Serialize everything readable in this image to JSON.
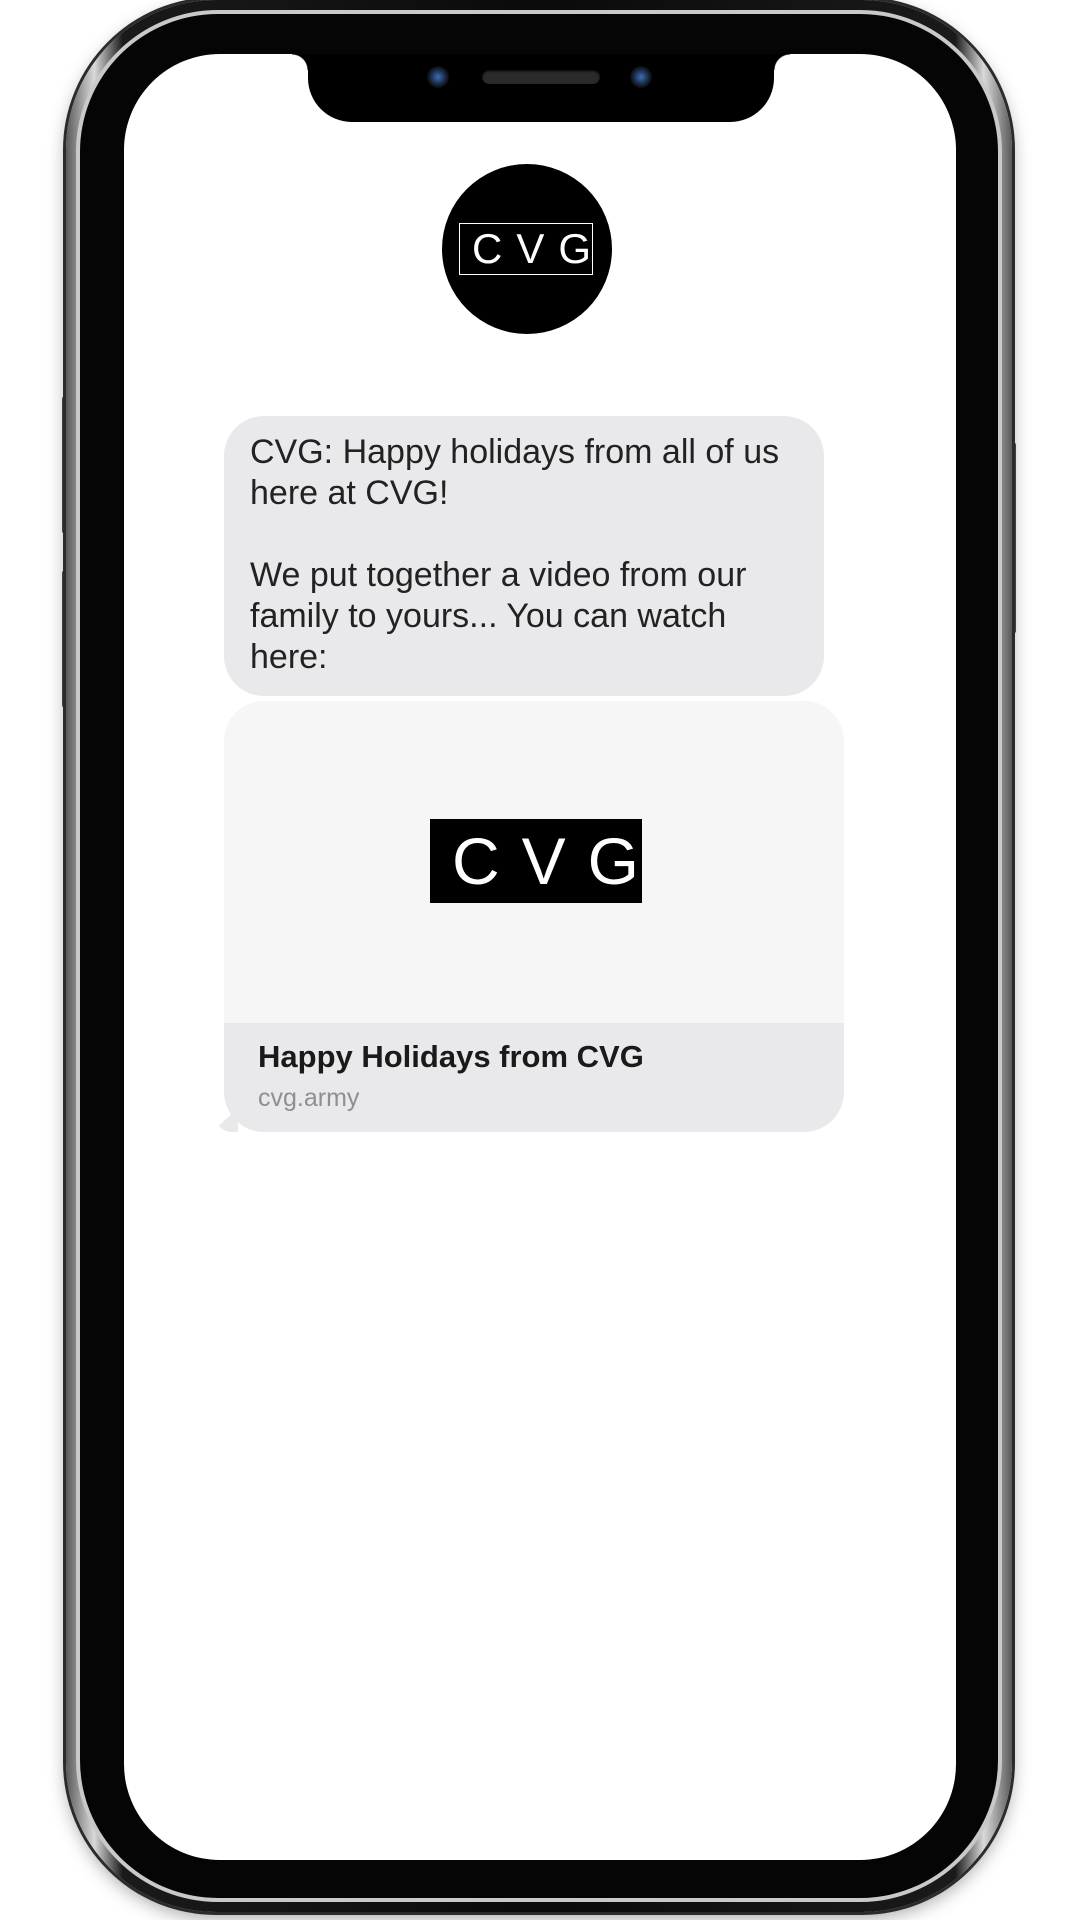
{
  "contact": {
    "avatar_text": "CVG",
    "avatar_icon": "cvg-logo-icon"
  },
  "messages": [
    {
      "text": "CVG: Happy holidays from all of us here at CVG!\n\nWe put together a video from our family to yours... You can watch here:"
    }
  ],
  "link_preview": {
    "image_text": "CVG",
    "title": "Happy Holidays from CVG",
    "domain": "cvg.army"
  },
  "colors": {
    "bubble_bg": "#e9e9eb",
    "preview_bg": "#f6f6f6",
    "domain_text": "#8e8e93"
  }
}
